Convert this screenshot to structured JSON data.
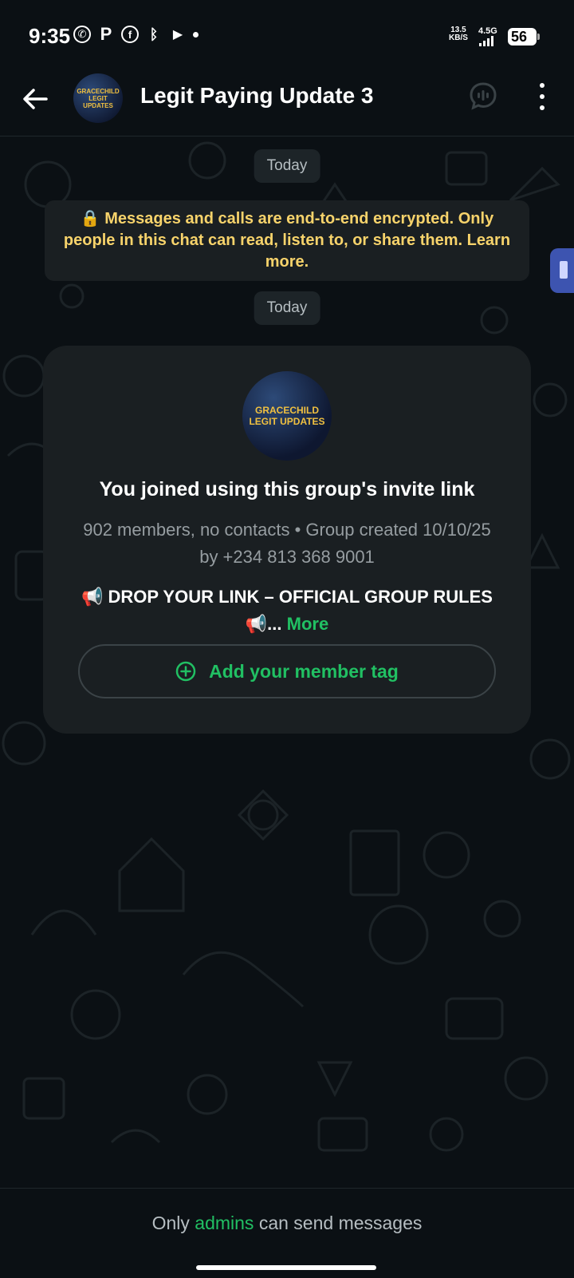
{
  "status_bar": {
    "time": "9:35",
    "network_speed_value": "13.5",
    "network_speed_unit": "KB/S",
    "network_type": "4.5G",
    "battery": "56",
    "icons": [
      "whatsapp-icon",
      "p-icon",
      "facebook-icon",
      "bluetooth-icon",
      "play-icon",
      "dot-icon"
    ]
  },
  "header": {
    "title": "Legit Paying Update 3",
    "avatar_text_line1": "GRACECHILD",
    "avatar_text_line2": "LEGIT UPDATES"
  },
  "chat": {
    "date_chip_1": "Today",
    "encryption_notice": "Messages and calls are end-to-end encrypted. Only people in this chat can read, listen to, or share them. Learn more.",
    "date_chip_2": "Today"
  },
  "group_card": {
    "avatar_text_line1": "GRACECHILD",
    "avatar_text_line2": "LEGIT UPDATES",
    "title": "You joined using this group's invite link",
    "subtitle": "902 members, no contacts • Group created 10/10/25 by +234 813 368 9001",
    "description": "📢 DROP YOUR LINK – OFFICIAL GROUP RULES 📢...",
    "more_label": "More",
    "member_tag_button": "Add your member tag"
  },
  "footer": {
    "prefix": "Only",
    "admins": "admins",
    "suffix": "can send messages"
  },
  "colors": {
    "background": "#0b1014",
    "accent": "#21c063",
    "notice": "#f7d36b",
    "card": "#1a1f22"
  }
}
